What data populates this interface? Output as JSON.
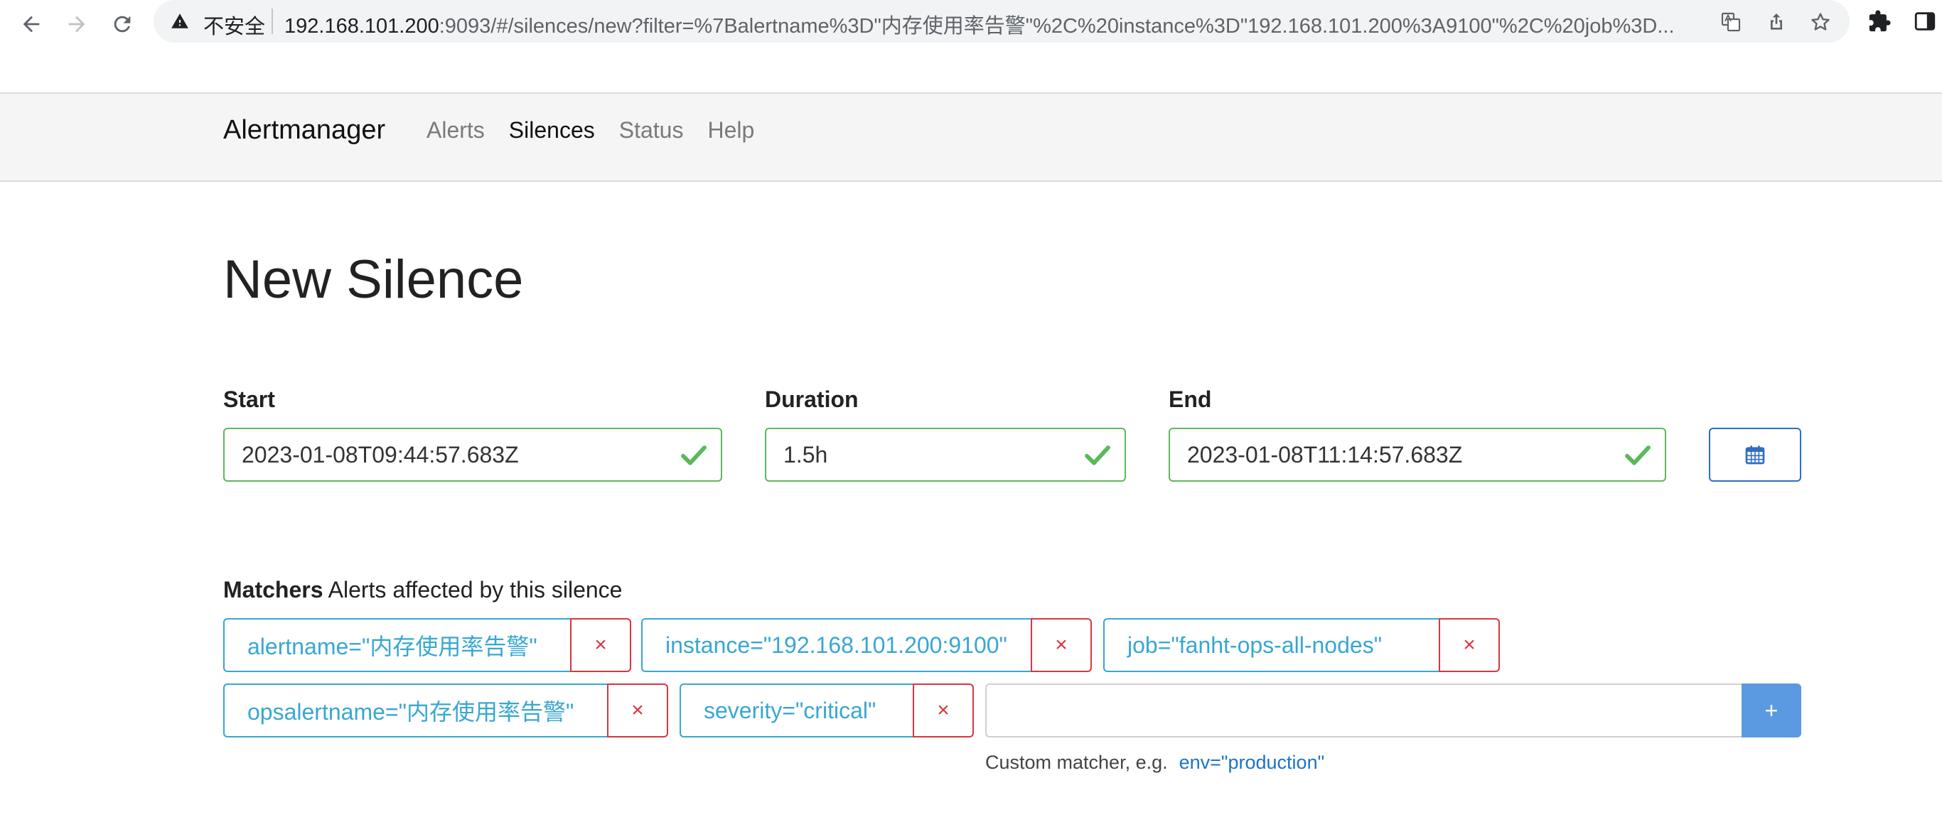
{
  "browser": {
    "insecure_label": "不安全",
    "url_host": "192.168.101.200",
    "url_rest": ":9093/#/silences/new?filter=%7Balertname%3D\"内存使用率告警\"%2C%20instance%3D\"192.168.101.200%3A9100\"%2C%20job%3D..."
  },
  "navbar": {
    "brand": "Alertmanager",
    "links": [
      {
        "label": "Alerts",
        "active": false
      },
      {
        "label": "Silences",
        "active": true
      },
      {
        "label": "Status",
        "active": false
      },
      {
        "label": "Help",
        "active": false
      }
    ]
  },
  "page": {
    "title": "New Silence"
  },
  "fields": {
    "start": {
      "label": "Start",
      "value": "2023-01-08T09:44:57.683Z"
    },
    "duration": {
      "label": "Duration",
      "value": "1.5h"
    },
    "end": {
      "label": "End",
      "value": "2023-01-08T11:14:57.683Z"
    }
  },
  "matchers": {
    "heading_bold": "Matchers",
    "heading_rest": "Alerts affected by this silence",
    "items": [
      "alertname=\"内存使用率告警\"",
      "instance=\"192.168.101.200:9100\"",
      "job=\"fanht-ops-all-nodes\"",
      "opsalertname=\"内存使用率告警\"",
      "severity=\"critical\""
    ],
    "delete_symbol": "×",
    "add_symbol": "+",
    "custom_value": "",
    "hint": "Custom matcher, e.g.",
    "hint_example": "env=\"production\""
  },
  "colors": {
    "valid_green": "#5cb85c",
    "matcher_blue": "#38a7d1",
    "delete_red": "#d9363e",
    "add_button": "#5b9ae0"
  }
}
